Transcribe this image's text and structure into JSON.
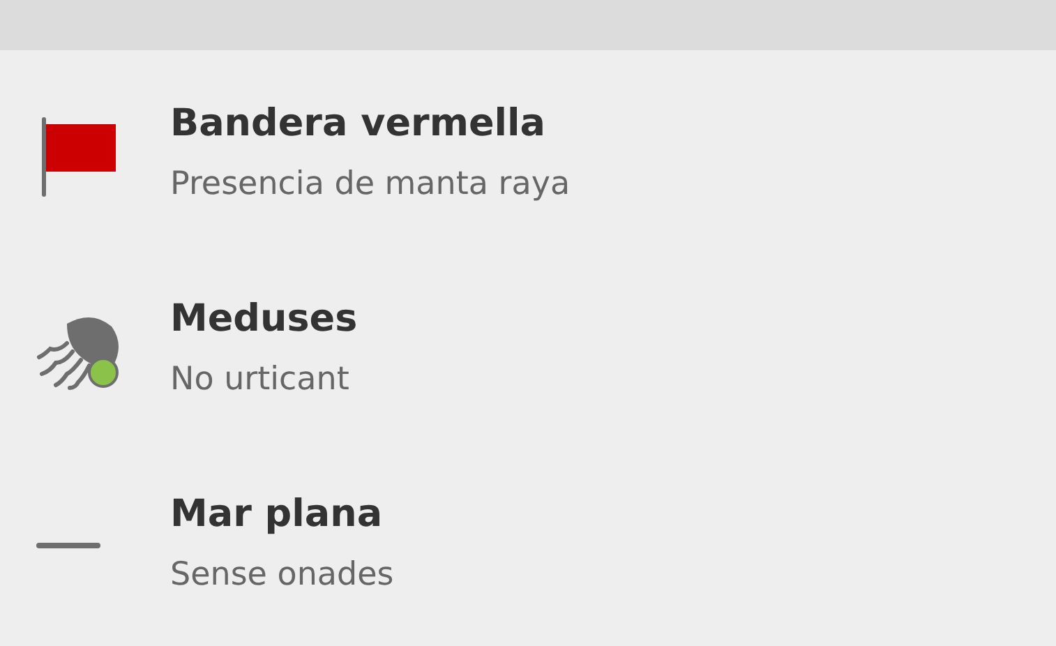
{
  "items": [
    {
      "kind": "flag",
      "color": "#cc0000",
      "title": "Bandera vermella",
      "subtitle": "Presencia de manta raya"
    },
    {
      "kind": "jellyfish",
      "color": "#8bc34a",
      "title": "Meduses",
      "subtitle": "No urticant"
    },
    {
      "kind": "flat",
      "title": "Mar plana",
      "subtitle": "Sense onades"
    }
  ]
}
